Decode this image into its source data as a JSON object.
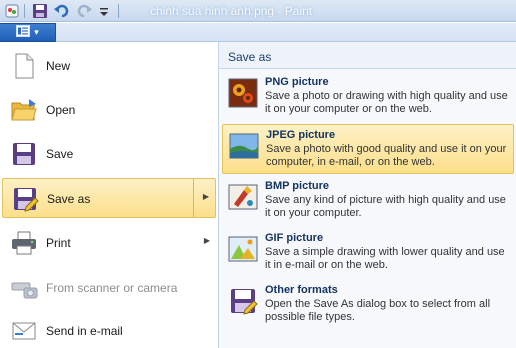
{
  "window": {
    "title": "chinh sua hinh anh.png - Paint"
  },
  "quick_access": {
    "icons": [
      "save-icon",
      "undo-icon",
      "redo-icon",
      "customize-dropdown-icon"
    ]
  },
  "app_button": {
    "icon": "paint-menu-icon",
    "arrow": "▾"
  },
  "left_menu": {
    "items": [
      {
        "label": "New",
        "icon": "new-document-icon"
      },
      {
        "label": "Open",
        "icon": "open-folder-icon"
      },
      {
        "label": "Save",
        "icon": "save-icon"
      },
      {
        "label": "Save as",
        "icon": "save-as-icon",
        "arrow": "▶"
      },
      {
        "label": "Print",
        "icon": "printer-icon",
        "arrow": "▶"
      },
      {
        "label": "From scanner or camera",
        "icon": "scanner-camera-icon"
      },
      {
        "label": "Send in e-mail",
        "icon": "email-icon"
      }
    ]
  },
  "save_as_panel": {
    "title": "Save as",
    "options": [
      {
        "title": "PNG picture",
        "desc": "Save a photo or drawing with high quality and use it on your computer or on the web.",
        "icon": "png-picture-icon"
      },
      {
        "title": "JPEG picture",
        "desc": "Save a photo with good quality and use it on your computer, in e-mail, or on the web.",
        "icon": "jpeg-picture-icon"
      },
      {
        "title": "BMP picture",
        "desc": "Save any kind of picture with high quality and use it on your computer.",
        "icon": "bmp-picture-icon"
      },
      {
        "title": "GIF picture",
        "desc": "Save a simple drawing with lower quality and use it in e-mail or on the web.",
        "icon": "gif-picture-icon"
      },
      {
        "title": "Other formats",
        "desc": "Open the Save As dialog box to select from all possible file types.",
        "icon": "other-formats-icon"
      }
    ]
  },
  "colors": {
    "highlight_top": "#fdf1c6",
    "highlight_bottom": "#fbdf8a",
    "app_button": "#2a6cc4"
  }
}
